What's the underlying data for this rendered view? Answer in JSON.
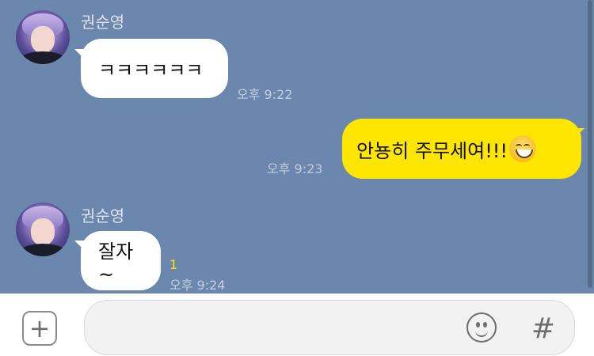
{
  "messages": [
    {
      "sender": "권순영",
      "direction": "incoming",
      "text": "ㅋㅋㅋㅋㅋㅋ",
      "time": "오후 9:22"
    },
    {
      "direction": "outgoing",
      "text": "안뇽히 주무세여!!!",
      "emoji": "grinning-face-emoji",
      "time": "오후 9:23"
    },
    {
      "sender": "권순영",
      "direction": "incoming",
      "text": "잘자~",
      "unread_count": "1",
      "time": "오후 9:24"
    }
  ],
  "input_bar": {
    "plus_icon": "plus-square-icon",
    "message_value": "",
    "emoticon_icon": "smile-icon",
    "hashtag_label": "#"
  },
  "colors": {
    "chat_background": "#6B87AE",
    "outgoing_bubble": "#FFE600",
    "incoming_bubble": "#FFFFFF",
    "unread_count": "#FFE600"
  }
}
